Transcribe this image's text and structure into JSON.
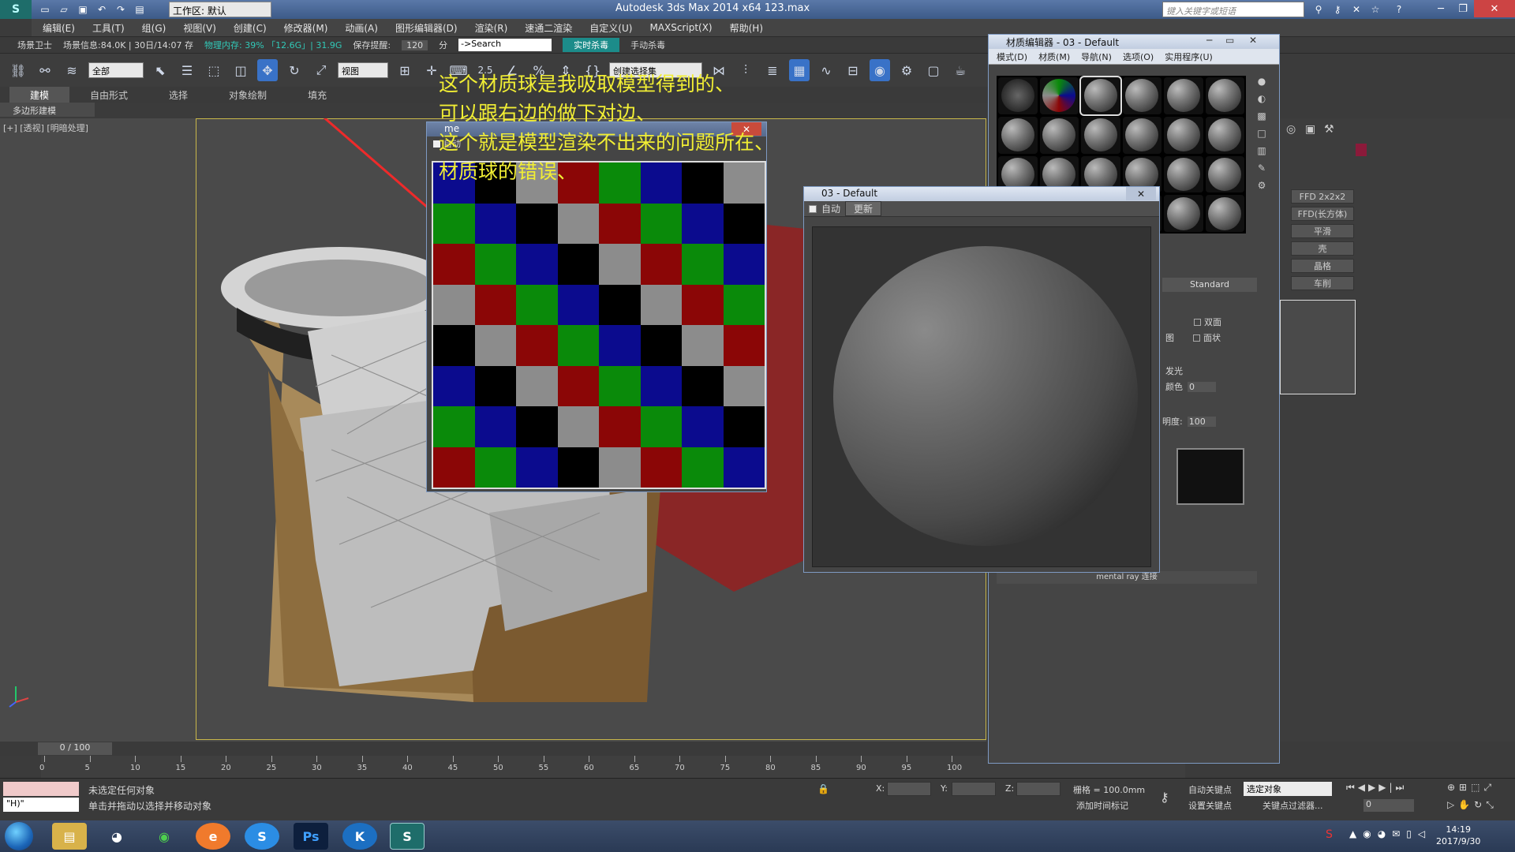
{
  "app": {
    "window_title": "Autodesk 3ds Max  2014 x64      123.max",
    "workspace": "工作区: 默认",
    "search_placeholder": "键入关键字或短语"
  },
  "menu": [
    "编辑(E)",
    "工具(T)",
    "组(G)",
    "视图(V)",
    "创建(C)",
    "修改器(M)",
    "动画(A)",
    "图形编辑器(D)",
    "渲染(R)",
    "速通二渲染",
    "自定义(U)",
    "MAXScript(X)",
    "帮助(H)"
  ],
  "infobar": {
    "scene_guard": "场景卫士",
    "scene_info": "场景信息:84.0K | 30日/14:07 存",
    "memory": "物理内存: 39% 「12.6G」| 31.9G",
    "save_reminder": "保存提醒:",
    "save_minutes": "120",
    "min": "分",
    "search": "->Search",
    "realtime": "实时杀毒",
    "manual": "手动杀毒"
  },
  "toolbar": {
    "filter": "全部",
    "coord": "视图",
    "snap": "2.5",
    "named_sel": "创建选择集"
  },
  "ribbon": {
    "tabs": [
      "建模",
      "自由形式",
      "选择",
      "对象绘制",
      "填充"
    ],
    "sub": "多边形建模"
  },
  "viewport": {
    "label": "[+] [透视] [明暗处理]"
  },
  "annotation": {
    "lines": [
      "这个材质球是我吸取模型得到的、",
      "可以跟右边的做下对边、",
      "这个就是模型渲染不出来的问题所在、",
      "材质球的错误、"
    ]
  },
  "me_window": {
    "title": "me",
    "auto": "自动",
    "checker_colors": [
      "#0a8a0a",
      "#0b0b8e",
      "#000000",
      "#8c8c8c",
      "#8b0606"
    ]
  },
  "preview_window": {
    "title": "03 - Default",
    "auto": "自动",
    "update": "更新"
  },
  "material_editor": {
    "title": "材质编辑器 - 03 - Default",
    "menu": [
      "模式(D)",
      "材质(M)",
      "导航(N)",
      "选项(O)",
      "实用程序(U)"
    ],
    "shader": "Standard",
    "two_sided": "双面",
    "faceted": "面状",
    "face_map": "图",
    "self_illum": "发光",
    "color": "颜色",
    "color_val": "0",
    "opacity": "明度:",
    "opacity_val": "100",
    "mr_conn": "mental ray 连接"
  },
  "command_panel": {
    "buttons": [
      "FFD 2x2x2",
      "FFD(长方体)",
      "平滑",
      "壳",
      "晶格",
      "车削"
    ]
  },
  "timeline": {
    "frame": "0 / 100",
    "ticks": [
      "0",
      "5",
      "10",
      "15",
      "20",
      "25",
      "30",
      "35",
      "40",
      "45",
      "50",
      "55",
      "60",
      "65",
      "70",
      "75",
      "80",
      "85",
      "90",
      "95",
      "100"
    ]
  },
  "status": {
    "maxscript": "\"H)\"",
    "line1": "未选定任何对象",
    "line2": "单击并拖动以选择并移动对象",
    "x": "X:",
    "y": "Y:",
    "z": "Z:",
    "grid": "栅格 = 100.0mm",
    "add_time_tag": "添加时间标记",
    "auto_key": "自动关键点",
    "set_key": "设置关键点",
    "selected": "选定对象",
    "key_filters": "关键点过滤器...",
    "frame_field": "0"
  },
  "taskbar": {
    "time": "14:19",
    "date": "2017/9/30"
  }
}
